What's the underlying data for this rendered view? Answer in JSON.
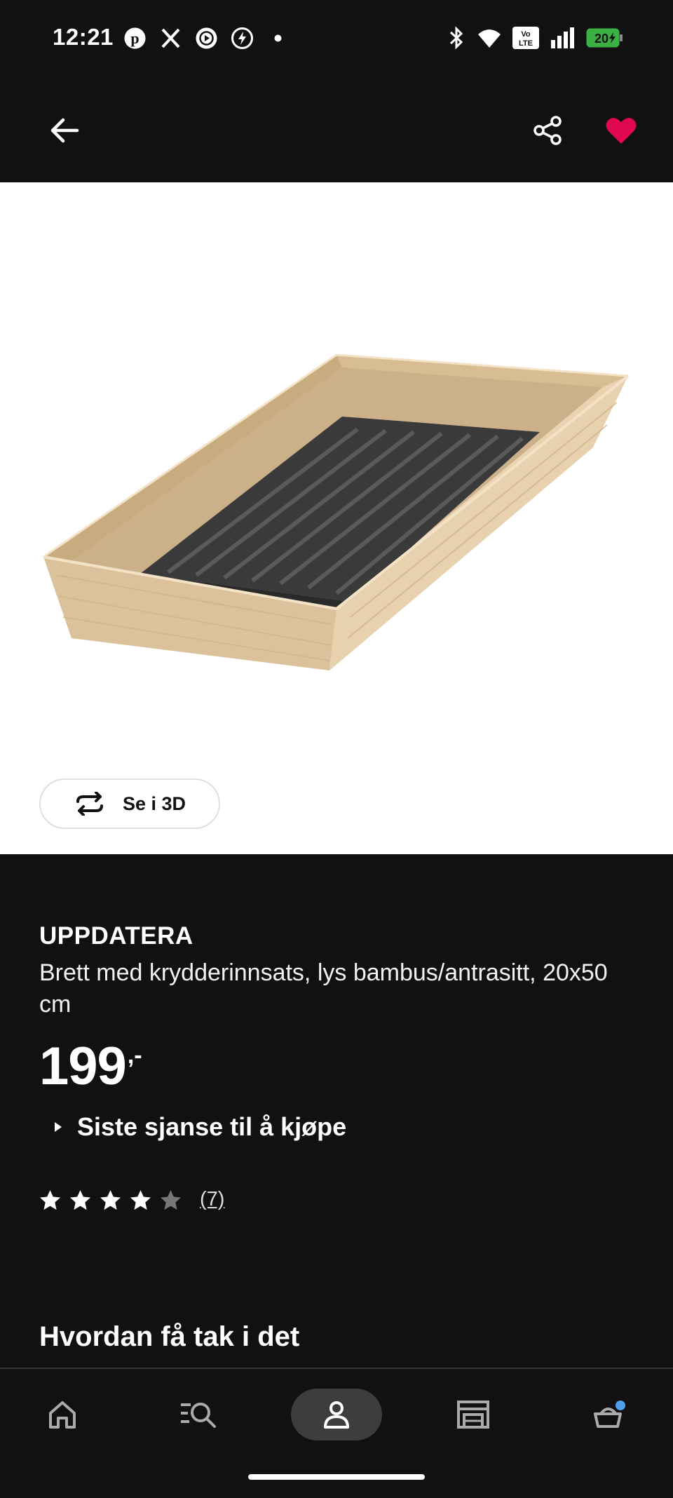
{
  "status_bar": {
    "time": "12:21",
    "left_icons": [
      "pinterest-icon",
      "x-icon",
      "play-icon",
      "lightning-icon",
      "dot-icon"
    ],
    "right_icons": [
      "bluetooth-icon",
      "wifi-icon",
      "volte-icon",
      "signal-icon",
      "battery-icon"
    ],
    "volte_label": "Vo LTE",
    "battery_level": "20"
  },
  "top_bar": {
    "back_icon": "arrow-left-icon",
    "share_icon": "share-icon",
    "favorite_icon": "heart-icon",
    "favorite_color": "#e00751"
  },
  "product": {
    "view_3d_label": "Se i 3D",
    "name": "UPPDATERA",
    "description": "Brett med krydderinnsats, lys bambus/antrasitt, 20x50 cm",
    "price": "199",
    "price_suffix": ",-",
    "last_chance": "Siste sjanse til å kjøpe",
    "rating": 4,
    "rating_max": 5,
    "rating_count": "(7)"
  },
  "section": {
    "title": "Hvordan få tak i det"
  },
  "bottom_nav": {
    "items": [
      "home-icon",
      "search-icon",
      "profile-icon",
      "store-icon",
      "cart-icon"
    ],
    "active": "profile-icon"
  }
}
